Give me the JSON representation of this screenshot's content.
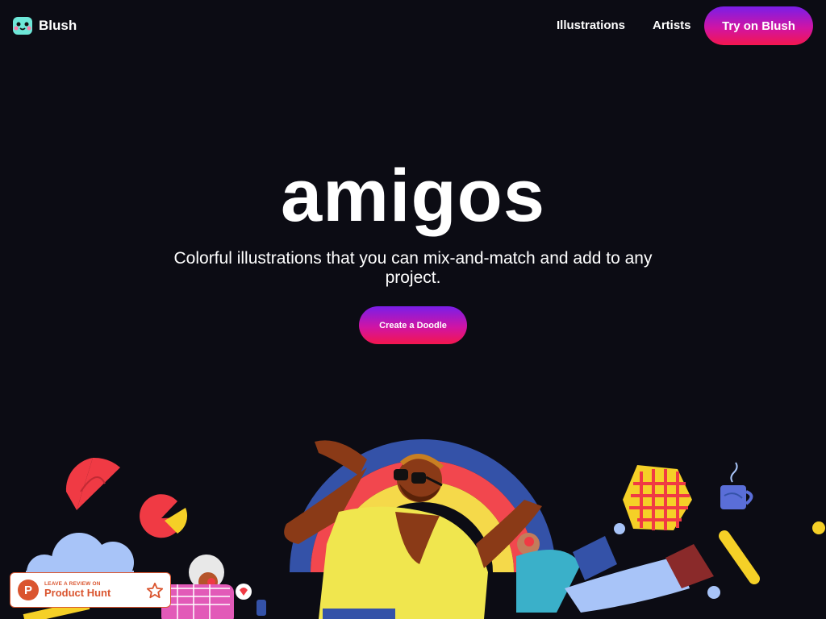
{
  "brand": {
    "name": "Blush",
    "logo_icon": "blush-face-icon"
  },
  "nav": {
    "links": [
      {
        "label": "Illustrations"
      },
      {
        "label": "Artists"
      }
    ],
    "cta_label": "Try on Blush"
  },
  "hero": {
    "title": "amigos",
    "subtitle": "Colorful illustrations that you can mix-and-match and add to any project.",
    "cta_label": "Create a Doodle"
  },
  "product_hunt": {
    "small_label": "LEAVE A REVIEW ON",
    "label": "Product Hunt",
    "logo_letter": "P",
    "icon": "star-icon"
  },
  "colors": {
    "background": "#0c0c14",
    "gradient_start": "#7a1ee8",
    "gradient_mid": "#d014a4",
    "gradient_end": "#f4164e",
    "product_hunt": "#da552f"
  }
}
